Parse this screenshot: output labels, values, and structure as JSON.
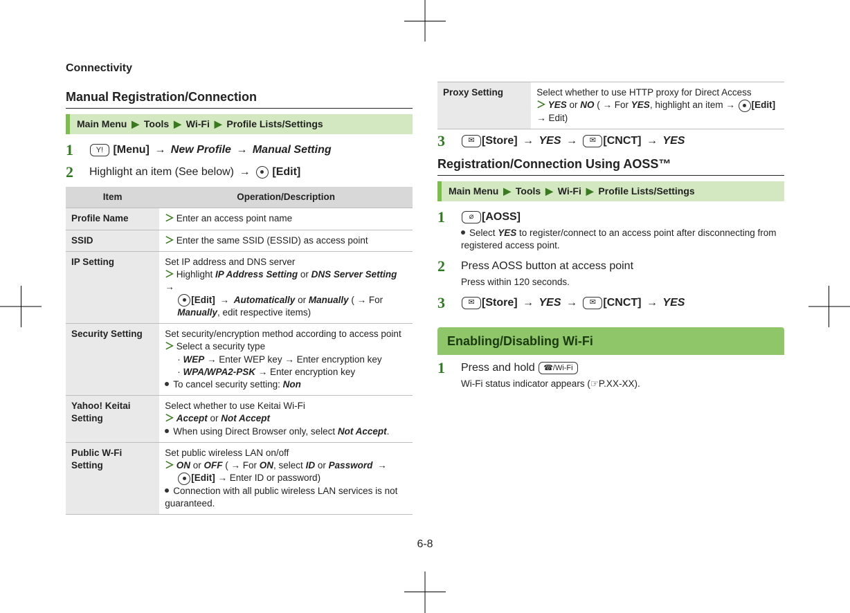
{
  "running_head": "Connectivity",
  "page_number": "6-8",
  "left": {
    "section_title": "Manual Registration/Connection",
    "nav": [
      "Main Menu",
      "Tools",
      "Wi-Fi",
      "Profile Lists/Settings"
    ],
    "step1": {
      "key": "Y!",
      "key_label": "[Menu]",
      "opt1": "New Profile",
      "opt2": "Manual Setting"
    },
    "step2": {
      "text": "Highlight an item (See below)",
      "edit": "[Edit]"
    },
    "table_head_item": "Item",
    "table_head_op": "Operation/Description",
    "rows": {
      "profile_name": {
        "item": "Profile Name",
        "desc": "Enter an access point name"
      },
      "ssid": {
        "item": "SSID",
        "desc": "Enter the same SSID (ESSID) as access point"
      },
      "ip": {
        "item": "IP Setting",
        "l1": "Set IP address and DNS server",
        "l2a": "Highlight ",
        "l2b": "IP Address Setting",
        "l2c": " or ",
        "l2d": "DNS Server Setting",
        "l3a": "[Edit]",
        "l3b": "Automatically",
        "l3c": " or ",
        "l3d": "Manually",
        "l3e": " ( → For ",
        "l3f": "Manually",
        "l3g": ", edit respective items)"
      },
      "sec": {
        "item": "Security Setting",
        "l1": "Set security/encryption method according to access point",
        "l2": "Select a security type",
        "l3a": "WEP",
        "l3b": " → Enter WEP key → Enter encryption key",
        "l4a": "WPA/WPA2-PSK",
        "l4b": " → Enter encryption key",
        "l5a": "To cancel security setting: ",
        "l5b": "Non"
      },
      "yahoo": {
        "item": "Yahoo! Keitai Setting",
        "l1": "Select whether to use Keitai Wi-Fi",
        "l2a": "Accept",
        "l2b": " or ",
        "l2c": "Not Accept",
        "l3a": "When using Direct Browser only, select ",
        "l3b": "Not Accept",
        "l3c": "."
      },
      "pub": {
        "item": "Public W-Fi Setting",
        "l1": "Set public wireless LAN on/off",
        "l2a": "ON",
        "l2b": " or ",
        "l2c": "OFF",
        "l2d": " ( → For ",
        "l2e": "ON",
        "l2f": ", select ",
        "l2g": "ID",
        "l2h": " or ",
        "l2i": "Password",
        "l3a": "[Edit]",
        "l3b": " → Enter ID or password)",
        "l4": "Connection with all public wireless LAN services is not guaranteed."
      }
    }
  },
  "right": {
    "proxy": {
      "item": "Proxy Setting",
      "l1": "Select whether to use HTTP proxy for Direct Access",
      "l2a": "YES",
      "l2b": " or ",
      "l2c": "NO",
      "l2d": " ( → For ",
      "l2e": "YES",
      "l2f": ", highlight an item → ",
      "l2g": "[Edit]",
      "l2h": " → Edit)"
    },
    "step3": {
      "store": "[Store]",
      "yes1": "YES",
      "cnct": "[CNCT]",
      "yes2": "YES"
    },
    "aoss_title": "Registration/Connection Using AOSS™",
    "aoss_nav": [
      "Main Menu",
      "Tools",
      "Wi-Fi",
      "Profile Lists/Settings"
    ],
    "aoss_s1": {
      "label": "[AOSS]",
      "sub_a": "Select ",
      "sub_b": "YES",
      "sub_c": " to register/connect to an access point after disconnecting from registered access point."
    },
    "aoss_s2": {
      "main": "Press AOSS button at access point",
      "sub": "Press within 120 seconds."
    },
    "aoss_s3": {
      "store": "[Store]",
      "yes1": "YES",
      "cnct": "[CNCT]",
      "yes2": "YES"
    },
    "band": "Enabling/Disabling Wi-Fi",
    "enable_s1": {
      "main": "Press and hold ",
      "key": "☎/Wi-Fi",
      "sub_a": "Wi-Fi status indicator appears (",
      "sub_b": "P.XX-XX).",
      "pointer": "☞"
    }
  }
}
